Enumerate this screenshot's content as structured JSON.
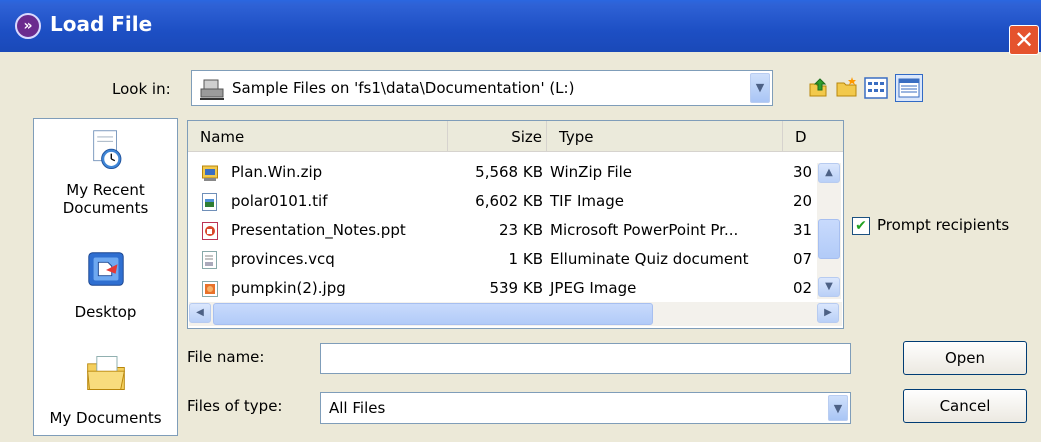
{
  "window": {
    "title": "Load File",
    "close_label": "✕",
    "logo_glyph": "»"
  },
  "look_in": {
    "label": "Look in:",
    "value": "Sample Files on 'fs1\\data\\Documentation' (L:)"
  },
  "toolbar": {
    "icons": [
      "up-one-level-icon",
      "create-new-folder-icon",
      "list-view-icon",
      "details-view-icon"
    ]
  },
  "places": [
    {
      "label_lines": [
        "My Recent",
        "Documents"
      ],
      "icon": "recent-documents-icon"
    },
    {
      "label_lines": [
        "Desktop"
      ],
      "icon": "desktop-icon"
    },
    {
      "label_lines": [
        "My Documents"
      ],
      "icon": "my-documents-icon"
    }
  ],
  "columns": {
    "name": "Name",
    "size": "Size",
    "type": "Type",
    "date": "D"
  },
  "files": [
    {
      "name": "Plan.Win.zip",
      "size": "5,568 KB",
      "type": "WinZip File",
      "date": "30",
      "icon": "zip-file-icon"
    },
    {
      "name": "polar0101.tif",
      "size": "6,602 KB",
      "type": "TIF Image",
      "date": "20",
      "icon": "tif-image-icon"
    },
    {
      "name": "Presentation_Notes.ppt",
      "size": "23 KB",
      "type": "Microsoft PowerPoint Pr...",
      "date": "31",
      "icon": "powerpoint-file-icon"
    },
    {
      "name": "provinces.vcq",
      "size": "1 KB",
      "type": "Elluminate Quiz document",
      "date": "07",
      "icon": "quiz-document-icon"
    },
    {
      "name": "pumpkin(2).jpg",
      "size": "539 KB",
      "type": "JPEG Image",
      "date": "02",
      "icon": "jpeg-image-icon"
    }
  ],
  "prompt_recipients": {
    "label": "Prompt recipients",
    "checked": true,
    "check_glyph": "✔"
  },
  "file_name": {
    "label": "File name:",
    "value": ""
  },
  "files_of_type": {
    "label": "Files of type:",
    "value": "All Files"
  },
  "buttons": {
    "open": "Open",
    "cancel": "Cancel"
  },
  "colors": {
    "title_bar": "#1d4fc4",
    "close": "#e5532d",
    "dialog_bg": "#ece9d8"
  }
}
